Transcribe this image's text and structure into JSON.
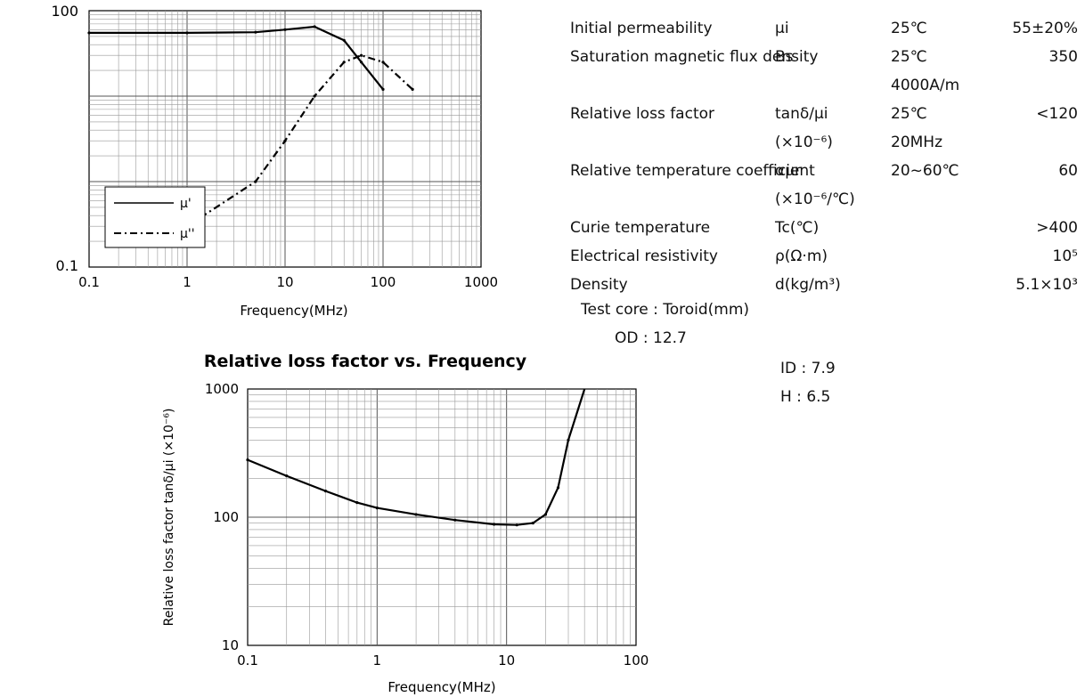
{
  "charts": {
    "top": {
      "title": "",
      "y_top_label": "100",
      "y_bottom_label": "0.1",
      "x_ticks": [
        "0.1",
        "1",
        "10",
        "100",
        "1000"
      ],
      "xlabel": "Frequency(MHz)",
      "legend": {
        "mu1": "μ'",
        "mu2": "μ''"
      }
    },
    "bottom": {
      "title": "Relative loss factor vs. Frequency",
      "y_ticks": [
        "1000",
        "100",
        "10"
      ],
      "x_ticks": [
        "0.1",
        "1",
        "10",
        "100"
      ],
      "xlabel": "Frequency(MHz)",
      "ylabel": "Relative loss factor tanδ/μi (×10⁻⁶)"
    }
  },
  "chart_data": [
    {
      "type": "line",
      "x_scale": "log",
      "y_scale": "log",
      "xlim": [
        0.1,
        1000
      ],
      "ylim": [
        0.1,
        100
      ],
      "series": [
        {
          "name": "μ'",
          "style": "solid",
          "x": [
            0.1,
            1,
            5,
            10,
            20,
            40,
            60,
            100
          ],
          "y": [
            55,
            55,
            56,
            60,
            65,
            45,
            25,
            12
          ]
        },
        {
          "name": "μ''",
          "style": "dashed",
          "x": [
            1,
            5,
            10,
            20,
            40,
            60,
            100,
            200
          ],
          "y": [
            0.3,
            1,
            3,
            10,
            25,
            30,
            25,
            12
          ]
        }
      ]
    },
    {
      "type": "line",
      "title": "Relative loss factor vs. Frequency",
      "x_scale": "log",
      "y_scale": "log",
      "xlim": [
        0.1,
        100
      ],
      "ylim": [
        10,
        1000
      ],
      "xlabel": "Frequency(MHz)",
      "ylabel": "Relative loss factor tanδ/μi (×10⁻⁶)",
      "series": [
        {
          "x": [
            0.1,
            0.2,
            0.4,
            0.7,
            1,
            2,
            4,
            8,
            12,
            16,
            20,
            25,
            30,
            40
          ],
          "y": [
            280,
            210,
            160,
            130,
            118,
            105,
            95,
            88,
            87,
            90,
            105,
            170,
            400,
            1200
          ]
        }
      ]
    }
  ],
  "properties": [
    {
      "name": "Initial permeability",
      "symbol": "μi",
      "condition": "25℃",
      "value": "55±20%"
    },
    {
      "name": "Saturation magnetic flux density",
      "symbol": "Bs",
      "condition": "25℃",
      "value": "350"
    },
    {
      "name": "",
      "symbol": "",
      "condition": "4000A/m",
      "value": ""
    },
    {
      "name": "Relative loss factor",
      "symbol": "tanδ/μi",
      "condition": "25℃",
      "value": "<120"
    },
    {
      "name": "",
      "symbol": "(×10⁻⁶)",
      "condition": "20MHz",
      "value": ""
    },
    {
      "name": "Relative temperature coefficient",
      "symbol": "αμr",
      "condition": "20~60℃",
      "value": "60"
    },
    {
      "name": "",
      "symbol": "(×10⁻⁶/℃)",
      "condition": "",
      "value": ""
    },
    {
      "name": "Curie temperature",
      "symbol": "Tc(℃)",
      "condition": "",
      "value": ">400"
    },
    {
      "name": "Electrical resistivity",
      "symbol": "ρ(Ω·m)",
      "condition": "",
      "value": "10⁵"
    },
    {
      "name": "Density",
      "symbol": "d(kg/m³)",
      "condition": "",
      "value": "5.1×10³"
    }
  ],
  "test_core": {
    "title": "Test core : Toroid(mm)",
    "od": "OD : 12.7",
    "id": "ID : 7.9",
    "h": "H : 6.5"
  }
}
